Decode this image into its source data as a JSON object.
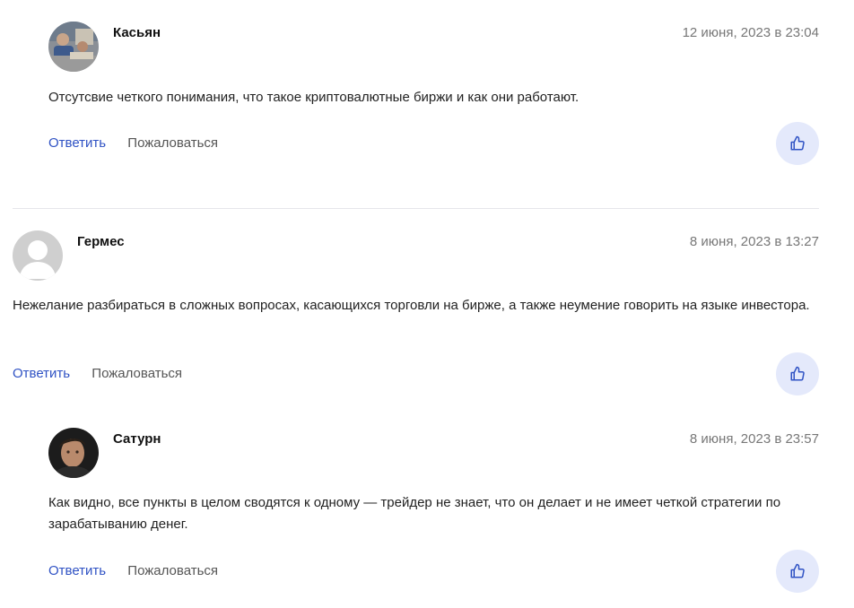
{
  "comments": [
    {
      "author": "Касьян",
      "date": "12 июня, 2023 в 23:04",
      "text": "Отсутсвие четкого понимания, что такое криптовалютные биржи и как они работают.",
      "reply_label": "Ответить",
      "report_label": "Пожаловаться",
      "avatar_icon": "photo-avatar-icon",
      "like_icon": "thumbs-up-icon"
    },
    {
      "author": "Гермес",
      "date": "8 июня, 2023 в 13:27",
      "text": "Нежелание разбираться в сложных вопросах, касающихся торговли на бирже, а также неумение говорить на языке инвестора.",
      "reply_label": "Ответить",
      "report_label": "Пожаловаться",
      "avatar_icon": "default-user-icon",
      "like_icon": "thumbs-up-icon"
    },
    {
      "author": "Сатурн",
      "date": "8 июня, 2023 в 23:57",
      "text": "Как видно, все пункты в целом сводятся к одному — трейдер не знает, что он делает и не имеет четкой стратегии по зарабатыванию денег.",
      "reply_label": "Ответить",
      "report_label": "Пожаловаться",
      "avatar_icon": "photo-avatar-icon",
      "like_icon": "thumbs-up-icon"
    }
  ],
  "colors": {
    "link": "#2f52c4",
    "like_bg": "#e4e9fb",
    "date": "#777777"
  }
}
